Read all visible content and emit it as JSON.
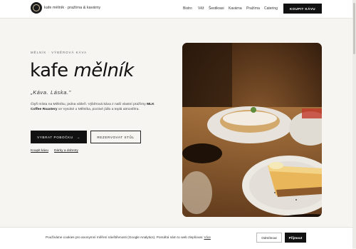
{
  "header": {
    "brand": "kafe mělník · pražírna & kavárny",
    "nav": [
      "Bistro",
      "Věž",
      "Šestikrasi",
      "Kavárna",
      "Pražírna",
      "Catering"
    ],
    "cta": "KOUPIT KÁVU"
  },
  "hero": {
    "eyebrow": "MĚLNÍK · VÝBĚROVÁ KÁVA",
    "title_plain": "kafe",
    "title_italic": "mělník",
    "quote": "„Káva. Láska.\"",
    "desc_before": "Čtyři místa na Mělníku, jedna vášeň. Výběrová káva z naší vlastní pražírny ",
    "desc_bold": "MLK Coffee Roastery",
    "desc_after": " ve Vysoké u Mělníka, poctivé jídlo a teplá atmosféra.",
    "btn_primary": "VYBRAT POBOČKU",
    "btn_primary_arrow": "→",
    "btn_secondary": "REZERVOVAT STŮL",
    "link_buy": "Koupit kávu",
    "link_gifts": "Dárky a dobroty"
  },
  "cookie": {
    "text": "Používáme cookies pro anonymní měření návštěvnosti (Google Analytics). Pomáhá nám to web zlepšovat.",
    "more": "Více",
    "deny": "Odmítnout",
    "accept": "Přijmout"
  },
  "icons": {
    "logo": "logo-icon",
    "arrow": "arrow-right-icon"
  }
}
